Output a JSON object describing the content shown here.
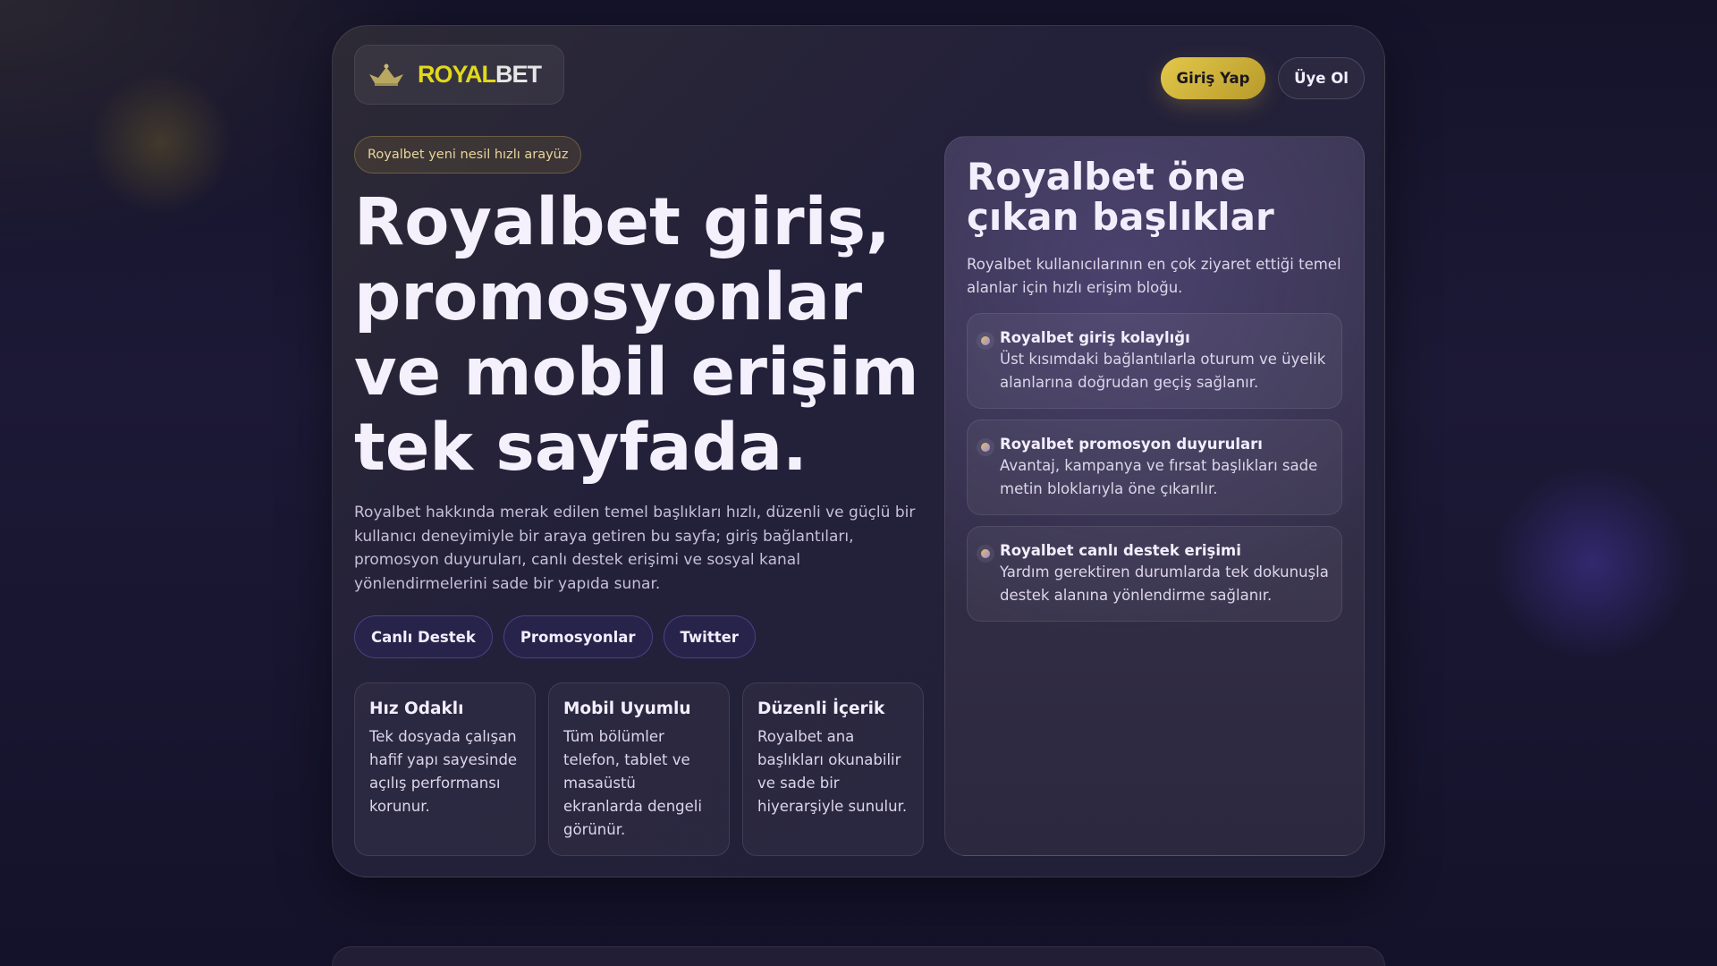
{
  "header": {
    "logo_text_yellow": "ROYAL",
    "logo_text_white": "BET",
    "login_label": "Giriş Yap",
    "register_label": "Üye Ol"
  },
  "hero": {
    "badge": "Royalbet yeni nesil hızlı arayüz",
    "title": "Royalbet giriş, promosyonlar ve mobil erişim tek sayfada.",
    "lead": "Royalbet hakkında merak edilen temel başlıkları hızlı, düzenli ve güçlü bir kullanıcı deneyimiyle bir araya getiren bu sayfa; giriş bağlantıları, promosyon duyuruları, canlı destek erişimi ve sosyal kanal yönlendirmelerini sade bir yapıda sunar.",
    "pills": [
      "Canlı Destek",
      "Promosyonlar",
      "Twitter"
    ]
  },
  "features": [
    {
      "title": "Hız Odaklı",
      "text": "Tek dosyada çalışan hafif yapı sayesinde açılış performansı korunur."
    },
    {
      "title": "Mobil Uyumlu",
      "text": "Tüm bölümler telefon, tablet ve masaüstü ekranlarda dengeli görünür."
    },
    {
      "title": "Düzenli İçerik",
      "text": "Royalbet ana başlıkları okunabilir ve sade bir hiyerarşiyle sunulur."
    }
  ],
  "side": {
    "title": "Royalbet öne çıkan başlıklar",
    "intro": "Royalbet kullanıcılarının en çok ziyaret ettiği temel alanlar için hızlı erişim bloğu.",
    "items": [
      {
        "title": "Royalbet giriş kolaylığı",
        "text": "Üst kısımdaki bağlantılarla oturum ve üyelik alanlarına doğrudan geçiş sağlanır."
      },
      {
        "title": "Royalbet promosyon duyuruları",
        "text": "Avantaj, kampanya ve fırsat başlıkları sade metin bloklarıyla öne çıkarılır."
      },
      {
        "title": "Royalbet canlı destek erişimi",
        "text": "Yardım gerektiren durumlarda tek dokunuşla destek alanına yönlendirme sağlanır."
      }
    ]
  }
}
